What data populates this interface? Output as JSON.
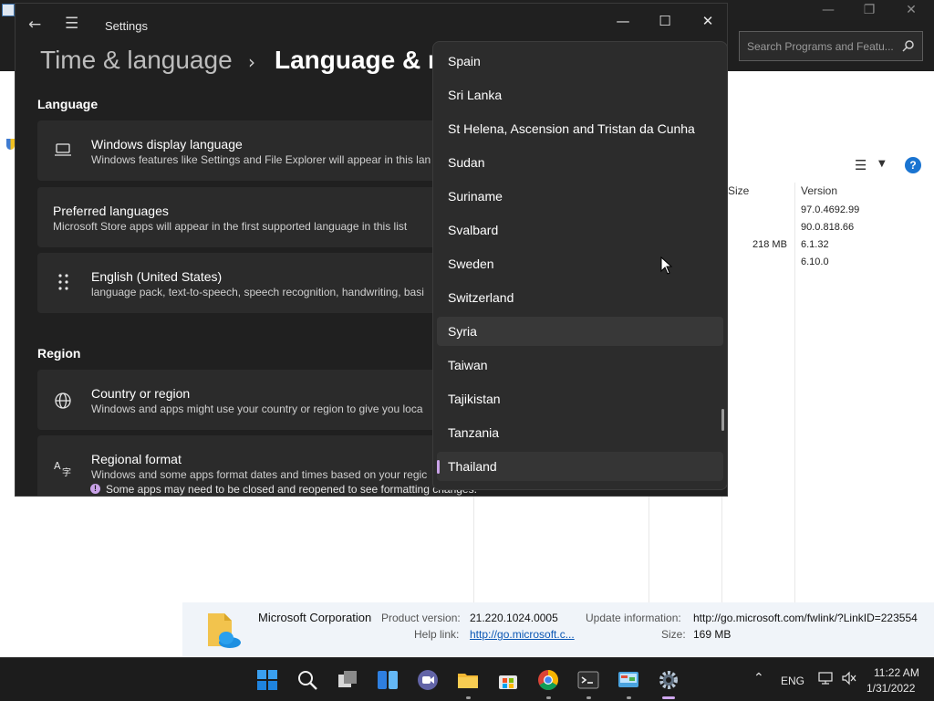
{
  "background_window": {
    "search_placeholder": "Search Programs and Featu...",
    "columns": {
      "size": "Size",
      "version": "Version"
    },
    "rows": [
      {
        "size": "",
        "version": "97.0.4692.99"
      },
      {
        "size": "",
        "version": "90.0.818.66"
      },
      {
        "size": "218 MB",
        "version": "6.1.32"
      },
      {
        "size": "",
        "version": "6.10.0"
      }
    ],
    "details": {
      "publisher": "Microsoft Corporation",
      "product_version_label": "Product version:",
      "product_version": "21.220.1024.0005",
      "help_link_label": "Help link:",
      "help_link": "http://go.microsoft.c...",
      "update_info_label": "Update information:",
      "update_info": "http://go.microsoft.com/fwlink/?LinkID=223554",
      "size_label": "Size:",
      "size": "169 MB"
    }
  },
  "settings": {
    "window_title": "Settings",
    "breadcrumb": {
      "parent": "Time & language",
      "current": "Language & re"
    },
    "language_section": "Language",
    "region_section": "Region",
    "cards": {
      "display_language": {
        "title": "Windows display language",
        "subtitle": "Windows features like Settings and File Explorer will appear in this lan"
      },
      "preferred_languages": {
        "title": "Preferred languages",
        "subtitle": "Microsoft Store apps will appear in the first supported language in this list"
      },
      "english": {
        "title": "English (United States)",
        "subtitle": "language pack, text-to-speech, speech recognition, handwriting, basi"
      },
      "country": {
        "title": "Country or region",
        "subtitle": "Windows and apps might use your country or region to give you loca"
      },
      "regional_format": {
        "title": "Regional format",
        "subtitle": "Windows and some apps format dates and times based on your regic"
      }
    },
    "notice": "Some apps may need to be closed and reopened to see formatting changes.",
    "dropdown_items": [
      "Spain",
      "Sri Lanka",
      "St Helena, Ascension and Tristan da Cunha",
      "Sudan",
      "Suriname",
      "Svalbard",
      "Sweden",
      "Switzerland",
      "Syria",
      "Taiwan",
      "Tajikistan",
      "Tanzania",
      "Thailand"
    ],
    "hovered_item": "Syria",
    "selected_item": "Thailand"
  },
  "taskbar": {
    "language": "ENG",
    "time": "11:22 AM",
    "date": "1/31/2022",
    "apps": [
      "start",
      "search",
      "task-view",
      "widgets",
      "chat",
      "file-explorer",
      "store",
      "chrome",
      "terminal",
      "control-panel",
      "settings"
    ]
  },
  "colors": {
    "accent": "#c9a2e8",
    "settings_bg": "#202020",
    "card_bg": "#2b2b2b",
    "dropdown_bg": "#2c2c2c"
  }
}
